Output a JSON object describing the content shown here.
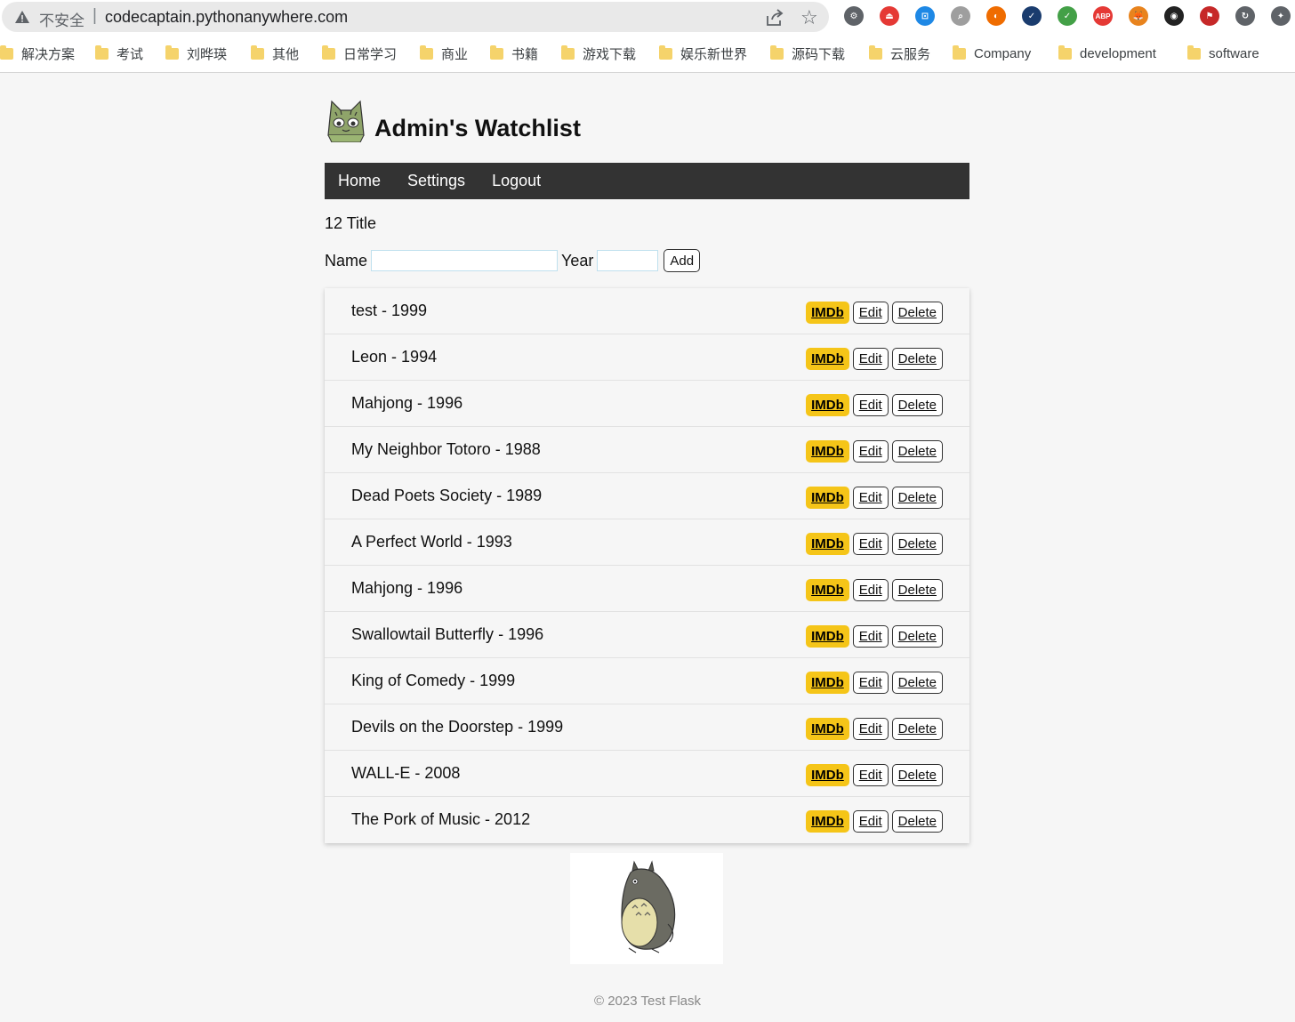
{
  "browser": {
    "security_label": "不安全",
    "separator": "|",
    "url": "codecaptain.pythonanywhere.com",
    "extensions": [
      "gear-extension",
      "red-extension",
      "blue-tab-extension",
      "search-extension",
      "swirl-extension",
      "check-extension",
      "shield-extension",
      "abp-extension",
      "fox-extension",
      "dark-extension",
      "red-flag-extension",
      "sync-extension",
      "puzzle-extension"
    ],
    "bookmarks": [
      "解决方案",
      "考试",
      "刘晔瑛",
      "其他",
      "日常学习",
      "商业",
      "书籍",
      "游戏下载",
      "娱乐新世界",
      "源码下载",
      "云服务",
      "Company",
      "development",
      "software"
    ]
  },
  "site": {
    "title": "Admin's Watchlist"
  },
  "nav": {
    "home": "Home",
    "settings": "Settings",
    "logout": "Logout"
  },
  "count_text": "12 Title",
  "form": {
    "name_label": "Name",
    "name_value": "",
    "year_label": "Year",
    "year_value": "",
    "add_label": "Add"
  },
  "movies": [
    {
      "title": "test",
      "year": "1999"
    },
    {
      "title": "Leon",
      "year": "1994"
    },
    {
      "title": "Mahjong",
      "year": "1996"
    },
    {
      "title": "My Neighbor Totoro",
      "year": "1988"
    },
    {
      "title": "Dead Poets Society",
      "year": "1989"
    },
    {
      "title": "A Perfect World",
      "year": "1993"
    },
    {
      "title": "Mahjong",
      "year": "1996"
    },
    {
      "title": "Swallowtail Butterfly",
      "year": "1996"
    },
    {
      "title": "King of Comedy",
      "year": "1999"
    },
    {
      "title": "Devils on the Doorstep",
      "year": "1999"
    },
    {
      "title": "WALL-E",
      "year": "2008"
    },
    {
      "title": "The Pork of Music",
      "year": "2012"
    }
  ],
  "row_actions": {
    "imdb": "IMDb",
    "edit": "Edit",
    "delete": "Delete",
    "title_year_separator": " - "
  },
  "footer": "© 2023 Test Flask",
  "colors": {
    "nav_bg": "#333333",
    "imdb_yellow": "#f5c518",
    "page_bg": "#f6f6f6"
  }
}
